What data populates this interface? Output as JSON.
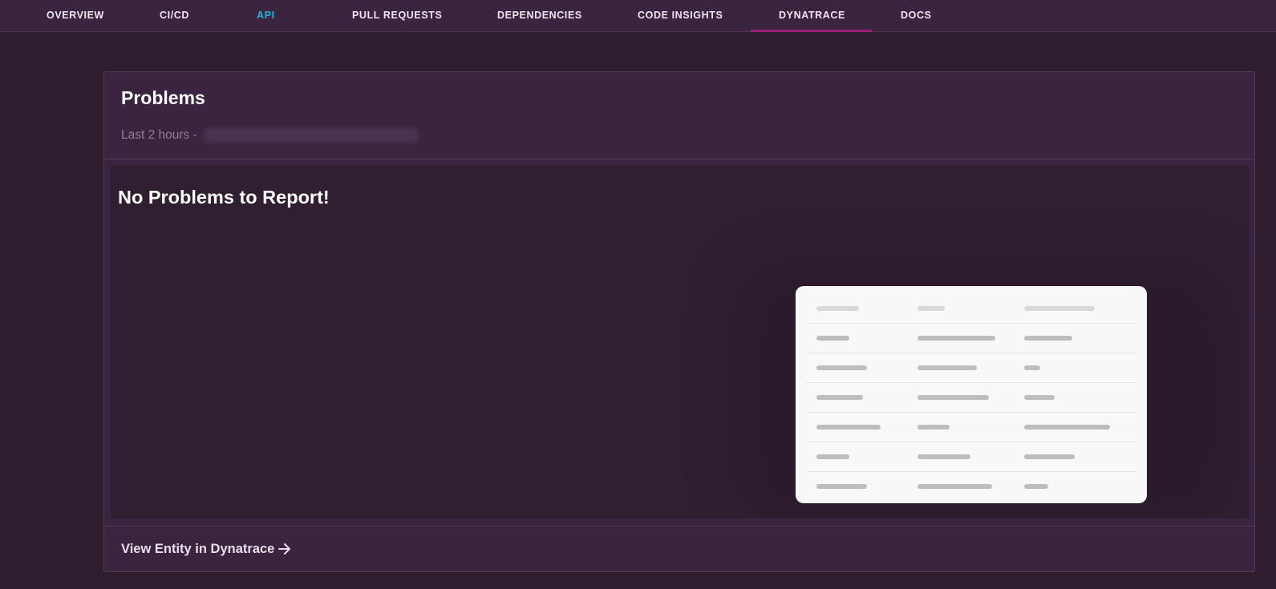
{
  "tabs": [
    {
      "label": "OVERVIEW"
    },
    {
      "label": "CI/CD"
    },
    {
      "label": "API"
    },
    {
      "label": "PULL REQUESTS"
    },
    {
      "label": "DEPENDENCIES"
    },
    {
      "label": "CODE INSIGHTS"
    },
    {
      "label": "DYNATRACE"
    },
    {
      "label": "DOCS"
    }
  ],
  "selected_tab": "DYNATRACE",
  "colors": {
    "background": "#2e1d2f",
    "surface": "#3b2440",
    "accent_text": "#1fb6d8",
    "tab_indicator": "#9b1f73"
  },
  "card": {
    "title": "Problems",
    "subtitle_prefix": "Last 2 hours -",
    "empty_message": "No Problems to Report!",
    "footer_link": "View Entity in Dynatrace",
    "footer_icon": "arrow-right-icon"
  }
}
